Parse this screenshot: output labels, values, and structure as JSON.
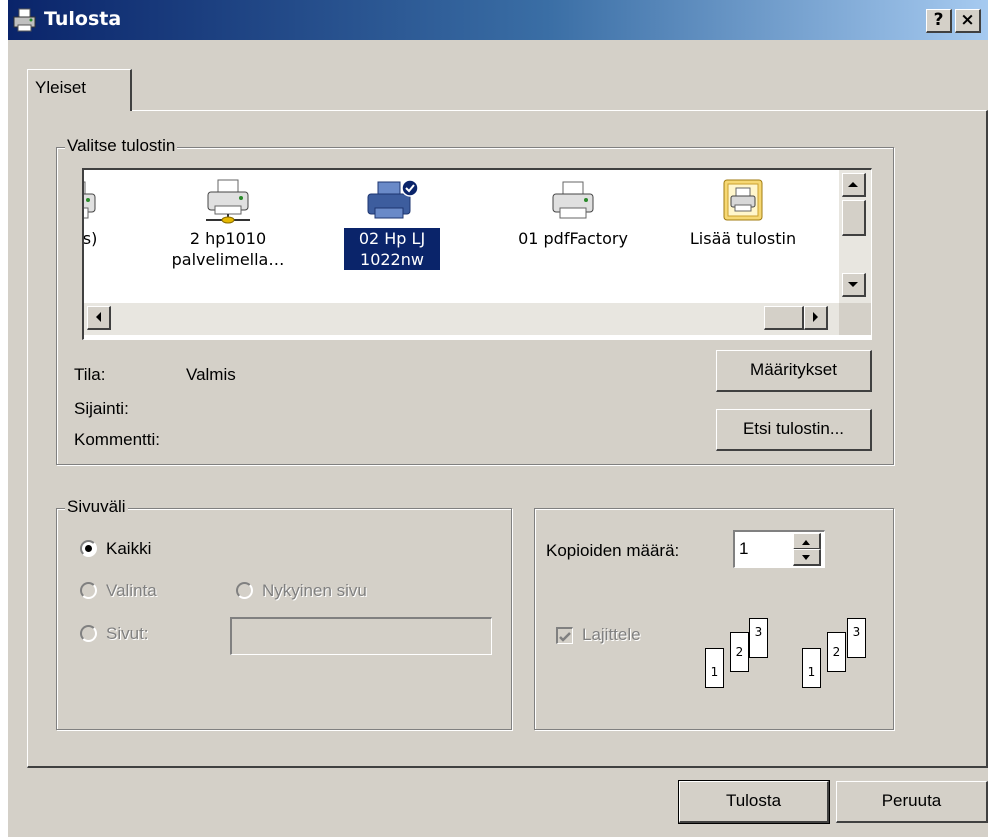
{
  "window": {
    "title": "Tulosta",
    "help_label": "?",
    "close_label": "×"
  },
  "tabs": [
    {
      "label": "Yleiset"
    }
  ],
  "printer_group": {
    "legend": "Valitse tulostin",
    "printers": [
      {
        "label": "nnos)",
        "icon": "printer-icon"
      },
      {
        "label": "2 hp1010 palvelimella…",
        "icon": "network-printer-icon"
      },
      {
        "label": "02 Hp LJ 1022nw",
        "icon": "default-printer-icon",
        "selected": true
      },
      {
        "label": "01 pdfFactory",
        "icon": "printer-icon"
      },
      {
        "label": "Lisää tulostin",
        "icon": "add-printer-icon"
      }
    ],
    "status_label": "Tila:",
    "status_value": "Valmis",
    "location_label": "Sijainti:",
    "location_value": "",
    "comment_label": "Kommentti:",
    "comment_value": "",
    "preferences_button": "Määritykset",
    "find_printer_button": "Etsi tulostin..."
  },
  "page_range": {
    "legend": "Sivuväli",
    "all_label": "Kaikki",
    "selection_label": "Valinta",
    "current_page_label": "Nykyinen sivu",
    "pages_label": "Sivut:",
    "pages_value": "",
    "selected": "all"
  },
  "copies": {
    "count_label": "Kopioiden määrä:",
    "count_value": "1",
    "collate_label": "Lajittele",
    "collate_checked": true,
    "collate_page_numbers": [
      "1",
      "2",
      "3"
    ]
  },
  "footer": {
    "print_button": "Tulosta",
    "cancel_button": "Peruuta"
  },
  "colors": {
    "title_gradient_start": "#0a246a",
    "title_gradient_end": "#a6caf0",
    "dialog_face": "#d4d0c8",
    "selection": "#0a246a"
  }
}
